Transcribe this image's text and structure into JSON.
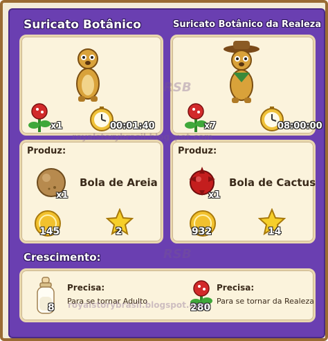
{
  "left": {
    "title": "Suricato Botânico",
    "seed_count": "x1",
    "time": "00:01:40",
    "produces_label": "Produz:",
    "product_name": "Bola de Areia",
    "product_count": "x1",
    "coins": "145",
    "stars": "2"
  },
  "right": {
    "title": "Suricato Botânico da Realeza",
    "seed_count": "x7",
    "time": "08:00:00",
    "produces_label": "Produz:",
    "product_name": "Bola de Cactus",
    "product_count": "x1",
    "coins": "932",
    "stars": "14"
  },
  "growth": {
    "title": "Crescimento:",
    "adult": {
      "count": "8",
      "needs": "Precisa:",
      "desc": "Para se tornar Adulto"
    },
    "royal": {
      "count": "280",
      "needs": "Precisa:",
      "desc": "Para se tornar da Realeza"
    }
  },
  "watermarks": {
    "logo": "RSB",
    "url": "royalstorybrasil.blogspot.com",
    "side": "royal"
  },
  "colors": {
    "panel": "#6a3fb1",
    "card": "#fbf3dc",
    "frame": "#9a6b33"
  }
}
